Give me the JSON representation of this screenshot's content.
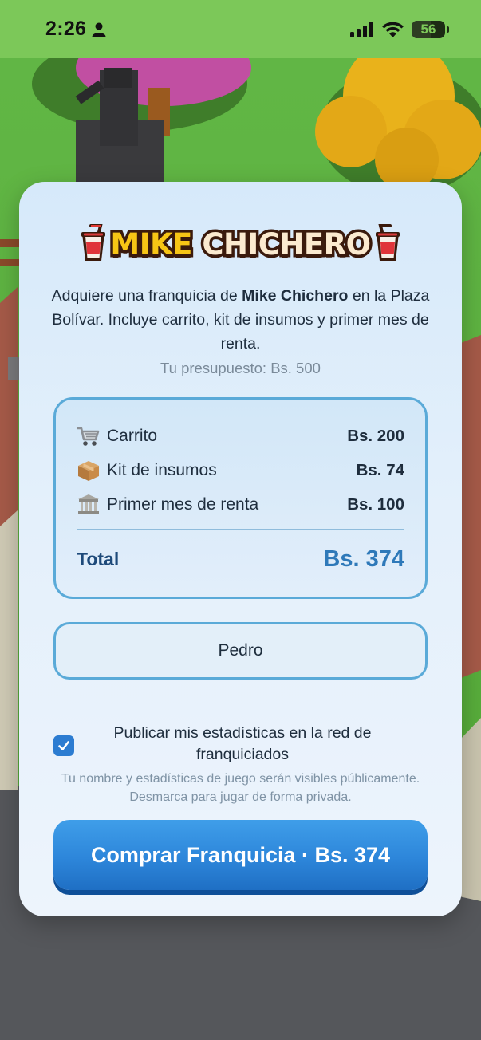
{
  "status_bar": {
    "time": "2:26",
    "battery_level": "56",
    "icons": [
      "person-icon",
      "signal-icon",
      "wifi-icon",
      "battery-icon"
    ]
  },
  "background": {
    "description_icons": [
      "statue",
      "pink-tree",
      "yellow-tree",
      "fence",
      "road"
    ],
    "colors": {
      "grass": "#5aaf3d",
      "road": "#5a5c60",
      "status_bar": "#7cc859"
    }
  },
  "modal": {
    "logo": {
      "word1": "MIKE",
      "word2": "CHICHERO",
      "icon": "cup-icon"
    },
    "description": {
      "before": "Adquiere una franquicia de ",
      "brand": "Mike Chichero",
      "after": " en la Plaza Bolívar. Incluye carrito, kit de insumos y primer mes de renta."
    },
    "budget": "Tu presupuesto: Bs. 500",
    "costs": [
      {
        "icon": "cart-icon",
        "label": "Carrito",
        "value": "Bs. 200"
      },
      {
        "icon": "box-icon",
        "label": "Kit de insumos",
        "value": "Bs. 74"
      },
      {
        "icon": "bank-icon",
        "label": "Primer mes de renta",
        "value": "Bs. 100"
      }
    ],
    "total": {
      "label": "Total",
      "value": "Bs. 374"
    },
    "name_input": {
      "value": "Pedro"
    },
    "publish_checkbox": {
      "checked": true,
      "label": "Publicar mis estadísticas en la red de franquiciados",
      "note": "Tu nombre y estadísticas de juego serán visibles públicamente. Desmarca para jugar de forma privada."
    },
    "buy_button": {
      "label": "Comprar Franquicia · Bs. 374"
    }
  },
  "colors": {
    "accent": "#2d86da",
    "logo_yellow": "#f7c515",
    "logo_cream": "#fbeacf",
    "logo_outline": "#3a1a0c",
    "total_blue": "#2e79b9"
  }
}
